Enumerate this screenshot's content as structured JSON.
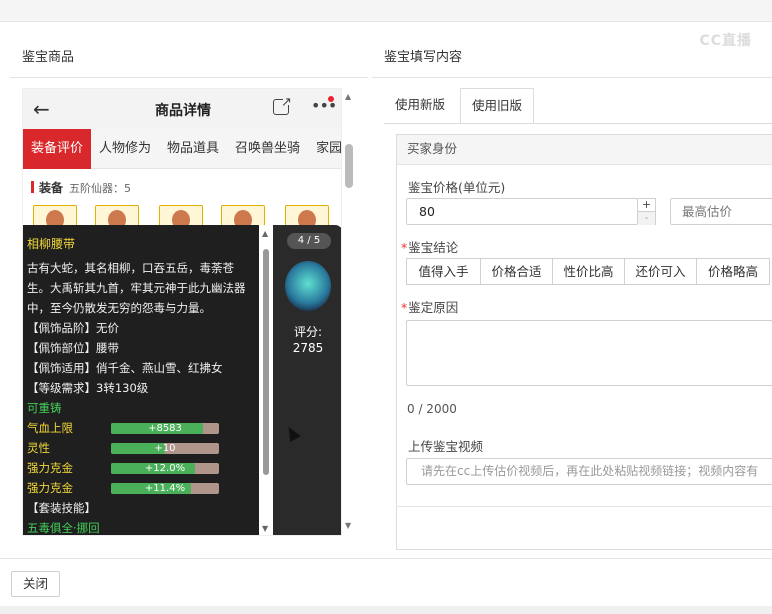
{
  "watermark": "CC直播",
  "left": {
    "section_title": "鉴宝商品",
    "phone": {
      "back_icon": "arrow-left-icon",
      "title": "商品详情",
      "tabs": [
        {
          "label": "装备评价",
          "active": true
        },
        {
          "label": "人物修为",
          "active": false
        },
        {
          "label": "物品道具",
          "active": false
        },
        {
          "label": "召唤兽坐骑",
          "active": false
        },
        {
          "label": "家园",
          "active": false
        }
      ],
      "equip_header": {
        "label": "装备",
        "sub": "五阶仙器：5"
      },
      "tooltip": {
        "name": "相柳腰带",
        "desc": "古有大蛇，其名相柳，口吞五岳，毒荼苍生。大禹斩其九首，牢其元神于此九幽法器中，至今仍散发无穷的怨毒与力量。",
        "attrs": [
          "【佩饰品阶】无价",
          "【佩饰部位】腰带",
          "【佩饰适用】俏千金、燕山雪、红拂女",
          "【等级需求】3转130级"
        ],
        "recast": "可重铸",
        "stats": [
          {
            "label": "气血上限",
            "value": "+8583",
            "fill": 0.85
          },
          {
            "label": "灵性",
            "value": "+10",
            "fill": 0.5
          },
          {
            "label": "强力克金",
            "value": "+12.0%",
            "fill": 0.78
          },
          {
            "label": "强力克金",
            "value": "+11.4%",
            "fill": 0.74
          }
        ],
        "set_skill": "【套装技能】",
        "next_line": "五毒俱全·挪回"
      },
      "side": {
        "count": "4 / 5",
        "score_label": "评分:",
        "score_value": "2785"
      }
    }
  },
  "right": {
    "section_title": "鉴宝填写内容",
    "tabs": [
      {
        "label": "使用新版",
        "active": false
      },
      {
        "label": "使用旧版",
        "active": true
      }
    ],
    "panel_header": "买家身份",
    "price_label": "鉴宝价格(单位元)",
    "price_value": "80",
    "stepper_plus": "+",
    "stepper_minus": "-",
    "max_placeholder": "最高估价",
    "conclusion_label": "鉴宝结论",
    "conclusion_options": [
      "值得入手",
      "价格合适",
      "性价比高",
      "还价可入",
      "价格略高"
    ],
    "reason_label": "鉴定原因",
    "counter": "0 / 2000",
    "video_label": "上传鉴宝视频",
    "video_placeholder": "请先在cc上传估价视频后，再在此处粘贴视频链接；视频内容有"
  },
  "footer": {
    "close_label": "关闭"
  }
}
